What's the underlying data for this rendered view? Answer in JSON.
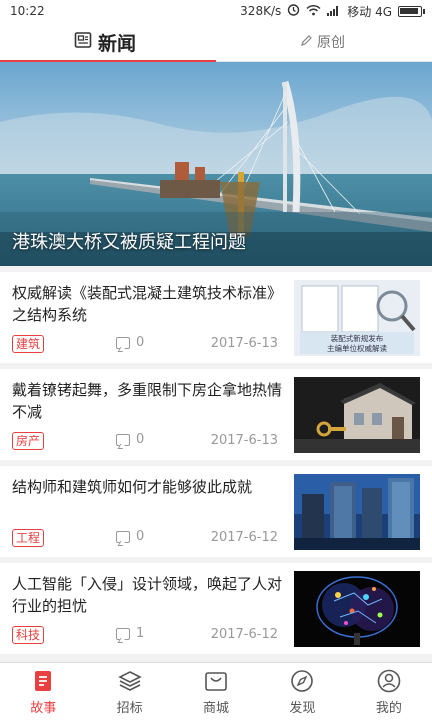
{
  "status_bar": {
    "time": "10:22",
    "network_speed": "328K/s",
    "carrier": "移动 4G"
  },
  "top_tabs": {
    "news_label": "新闻",
    "original_label": "原创"
  },
  "hero": {
    "title": "港珠澳大桥又被质疑工程问题"
  },
  "articles": [
    {
      "title": "权威解读《装配式混凝土建筑技术标准》之结构系统",
      "tag": "建筑",
      "comments": "0",
      "date": "2017-6-13",
      "thumb_caption_1": "装配式新规发布",
      "thumb_caption_2": "主编单位权威解读"
    },
    {
      "title": "戴着镣铐起舞，多重限制下房企拿地热情不减",
      "tag": "房产",
      "comments": "0",
      "date": "2017-6-13"
    },
    {
      "title": "结构师和建筑师如何才能够彼此成就",
      "tag": "工程",
      "comments": "0",
      "date": "2017-6-12"
    },
    {
      "title": "人工智能「入侵」设计领域，唤起了人对行业的担忧",
      "tag": "科技",
      "comments": "1",
      "date": "2017-6-12"
    }
  ],
  "bottom_nav": [
    {
      "label": "故事",
      "icon": "story-icon",
      "active": true
    },
    {
      "label": "招标",
      "icon": "layers-icon",
      "active": false
    },
    {
      "label": "商城",
      "icon": "shop-bag-icon",
      "active": false
    },
    {
      "label": "发现",
      "icon": "compass-icon",
      "active": false
    },
    {
      "label": "我的",
      "icon": "user-icon",
      "active": false
    }
  ],
  "colors": {
    "accent": "#e84040",
    "text_muted": "#999999"
  }
}
